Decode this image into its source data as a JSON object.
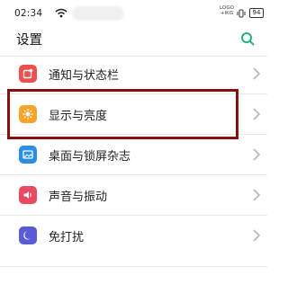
{
  "status_bar": {
    "time": "02:34",
    "network_top": "LOGO",
    "network_bottom": "+IKG",
    "battery": "94"
  },
  "header": {
    "title": "设置"
  },
  "settings": [
    {
      "label": "通知与状态栏",
      "icon": "notification-icon",
      "color": "#ef4f4f"
    },
    {
      "label": "显示与亮度",
      "icon": "sun-icon",
      "color": "#f6a52a"
    },
    {
      "label": "桌面与锁屏杂志",
      "icon": "image-icon",
      "color": "#2a8ee6"
    },
    {
      "label": "声音与振动",
      "icon": "speaker-icon",
      "color": "#e84a5f"
    },
    {
      "label": "免打扰",
      "icon": "moon-icon",
      "color": "#5b5bd6"
    }
  ],
  "accent": "#22b07d",
  "highlight_color": "#8a1010"
}
